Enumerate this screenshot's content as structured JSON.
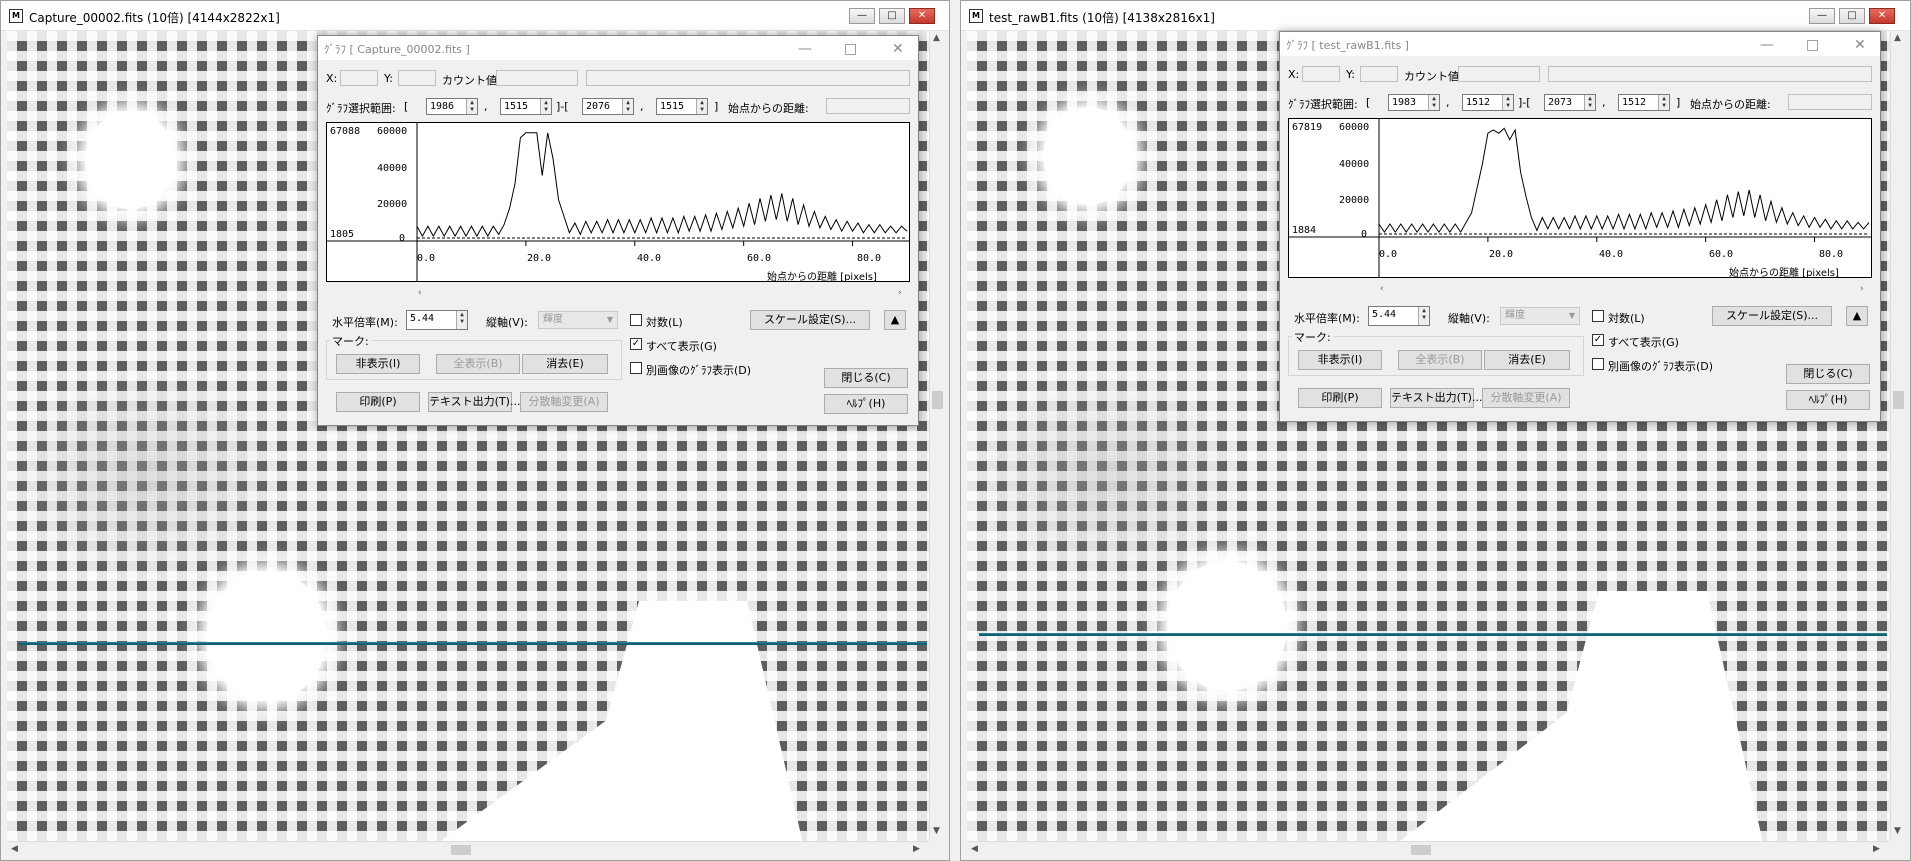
{
  "left": {
    "window_title": "Capture_00002.fits (10倍) [4144x2822x1]",
    "dialog": {
      "title": "ｸﾞﾗﾌ [ Capture_00002.fits ]",
      "x_label": "X:",
      "y_label": "Y:",
      "count_label": "カウント値:",
      "range_label": "ｸﾞﾗﾌ選択範囲:",
      "bracket_open": "[",
      "comma": ",",
      "range_sep": "]-[",
      "bracket_close": "]",
      "range": [
        "1986",
        "1515",
        "2076",
        "1515"
      ],
      "distance_label": "始点からの距離:",
      "graph": {
        "max_label": "67088",
        "min_label": "1805",
        "y_ticks": [
          "60000",
          "40000",
          "20000",
          "0"
        ],
        "x_ticks": [
          "0.0",
          "20.0",
          "40.0",
          "60.0",
          "80.0"
        ],
        "x_axis_label": "始点からの距離 [pixels]"
      },
      "h_scale_label": "水平倍率(M):",
      "h_scale_value": "5.44",
      "v_axis_label": "縦軸(V):",
      "v_axis_value": "輝度",
      "log_label": "対数(L)",
      "show_all_label": "すべて表示(G)",
      "other_image_label": "別画像のｸﾞﾗﾌ表示(D)",
      "scale_settings_label": "スケール設定(S)...",
      "up_label": "▲",
      "mark_label": "マーク:",
      "hide_label": "非表示(I)",
      "show_all_mark_label": "全表示(B)",
      "delete_label": "消去(E)",
      "close_label": "閉じる(C)",
      "print_label": "印刷(P)",
      "text_output_label": "テキスト出力(T)...",
      "dispersion_label": "分散軸変更(A)",
      "help_label": "ﾍﾙﾌﾟ(H)",
      "log_checked": false,
      "show_all_checked": true,
      "other_image_checked": false
    }
  },
  "right": {
    "window_title": "test_rawB1.fits (10倍) [4138x2816x1]",
    "dialog": {
      "title": "ｸﾞﾗﾌ [ test_rawB1.fits ]",
      "x_label": "X:",
      "y_label": "Y:",
      "count_label": "カウント値:",
      "range_label": "ｸﾞﾗﾌ選択範囲:",
      "bracket_open": "[",
      "comma": ",",
      "range_sep": "]-[",
      "bracket_close": "]",
      "range": [
        "1983",
        "1512",
        "2073",
        "1512"
      ],
      "distance_label": "始点からの距離:",
      "graph": {
        "max_label": "67819",
        "min_label": "1884",
        "y_ticks": [
          "60000",
          "40000",
          "20000",
          "0"
        ],
        "x_ticks": [
          "0.0",
          "20.0",
          "40.0",
          "60.0",
          "80.0"
        ],
        "x_axis_label": "始点からの距離 [pixels]"
      },
      "h_scale_label": "水平倍率(M):",
      "h_scale_value": "5.44",
      "v_axis_label": "縦軸(V):",
      "v_axis_value": "輝度",
      "log_label": "対数(L)",
      "show_all_label": "すべて表示(G)",
      "other_image_label": "別画像のｸﾞﾗﾌ表示(D)",
      "scale_settings_label": "スケール設定(S)...",
      "up_label": "▲",
      "mark_label": "マーク:",
      "hide_label": "非表示(I)",
      "show_all_mark_label": "全表示(B)",
      "delete_label": "消去(E)",
      "close_label": "閉じる(C)",
      "print_label": "印刷(P)",
      "text_output_label": "テキスト出力(T)...",
      "dispersion_label": "分散軸変更(A)",
      "help_label": "ﾍﾙﾌﾟ(H)",
      "log_checked": false,
      "show_all_checked": true,
      "other_image_checked": false
    }
  },
  "window_controls": {
    "minimize": "—",
    "maximize": "□",
    "close": "✕"
  },
  "dialog_controls": {
    "minimize": "—",
    "maximize": "□",
    "close": "✕"
  },
  "chart_data": [
    {
      "type": "line",
      "xlim": [
        0,
        90
      ],
      "ylim": [
        0,
        67088
      ],
      "baseline": 1805,
      "x": [
        0,
        1,
        2,
        3,
        4,
        5,
        6,
        7,
        8,
        9,
        10,
        11,
        12,
        13,
        14,
        15,
        16,
        17,
        18,
        19,
        20,
        21,
        22,
        23,
        24,
        25,
        26,
        27,
        28,
        29,
        30,
        31,
        32,
        33,
        34,
        35,
        36,
        37,
        38,
        39,
        40,
        41,
        42,
        43,
        44,
        45,
        46,
        47,
        48,
        49,
        50,
        51,
        52,
        53,
        54,
        55,
        56,
        57,
        58,
        59,
        60,
        61,
        62,
        63,
        64,
        65,
        66,
        67,
        68,
        69,
        70,
        71,
        72,
        73,
        74,
        75,
        76,
        77,
        78,
        79,
        80,
        81,
        82,
        83,
        84,
        85,
        86,
        87,
        88,
        89,
        90
      ],
      "y": [
        9000,
        3000,
        9000,
        3000,
        9000,
        3000,
        9000,
        3000,
        9000,
        3000,
        9000,
        3000,
        9000,
        3000,
        9000,
        4000,
        10000,
        20000,
        35000,
        63000,
        66000,
        66000,
        66000,
        40000,
        66000,
        50000,
        25000,
        15000,
        5000,
        11000,
        4000,
        12000,
        5000,
        12000,
        5000,
        13000,
        5000,
        13000,
        5000,
        13000,
        5000,
        13000,
        5000,
        14000,
        5000,
        14000,
        5000,
        14000,
        5000,
        15000,
        6000,
        15000,
        6000,
        16000,
        6000,
        17000,
        7000,
        18000,
        8000,
        20000,
        9000,
        23000,
        10000,
        26000,
        12000,
        28000,
        13000,
        29000,
        12000,
        26000,
        10000,
        22000,
        9000,
        18000,
        8000,
        15000,
        7000,
        13000,
        6000,
        12000,
        6000,
        11000,
        5000,
        10000,
        5000,
        10000,
        5000,
        9000,
        5000,
        9000,
        6000
      ]
    },
    {
      "type": "line",
      "xlim": [
        0,
        90
      ],
      "ylim": [
        0,
        67819
      ],
      "baseline": 1884,
      "x": [
        0,
        1,
        2,
        3,
        4,
        5,
        6,
        7,
        8,
        9,
        10,
        11,
        12,
        13,
        14,
        15,
        16,
        17,
        18,
        19,
        20,
        21,
        22,
        23,
        24,
        25,
        26,
        27,
        28,
        29,
        30,
        31,
        32,
        33,
        34,
        35,
        36,
        37,
        38,
        39,
        40,
        41,
        42,
        43,
        44,
        45,
        46,
        47,
        48,
        49,
        50,
        51,
        52,
        53,
        54,
        55,
        56,
        57,
        58,
        59,
        60,
        61,
        62,
        63,
        64,
        65,
        66,
        67,
        68,
        69,
        70,
        71,
        72,
        73,
        74,
        75,
        76,
        77,
        78,
        79,
        80,
        81,
        82,
        83,
        84,
        85,
        86,
        87,
        88,
        89,
        90
      ],
      "y": [
        8000,
        3000,
        8000,
        3000,
        8000,
        3000,
        8000,
        3000,
        8000,
        3000,
        8000,
        3000,
        8000,
        3000,
        8000,
        3000,
        9000,
        15000,
        30000,
        45000,
        64000,
        66000,
        64000,
        67000,
        60000,
        66000,
        40000,
        25000,
        12000,
        4000,
        12000,
        5000,
        12000,
        5000,
        12000,
        5000,
        13000,
        5000,
        13000,
        5000,
        13000,
        5000,
        13000,
        5000,
        14000,
        5000,
        14000,
        5000,
        14000,
        5000,
        15000,
        6000,
        15000,
        6000,
        16000,
        6000,
        17000,
        7000,
        18000,
        8000,
        20000,
        9000,
        23000,
        10000,
        26000,
        12000,
        28000,
        13000,
        29000,
        12000,
        26000,
        10000,
        22000,
        9000,
        18000,
        8000,
        15000,
        7000,
        13000,
        6000,
        12000,
        6000,
        11000,
        5000,
        10000,
        5000,
        10000,
        5000,
        9000,
        5000,
        9000
      ]
    }
  ]
}
